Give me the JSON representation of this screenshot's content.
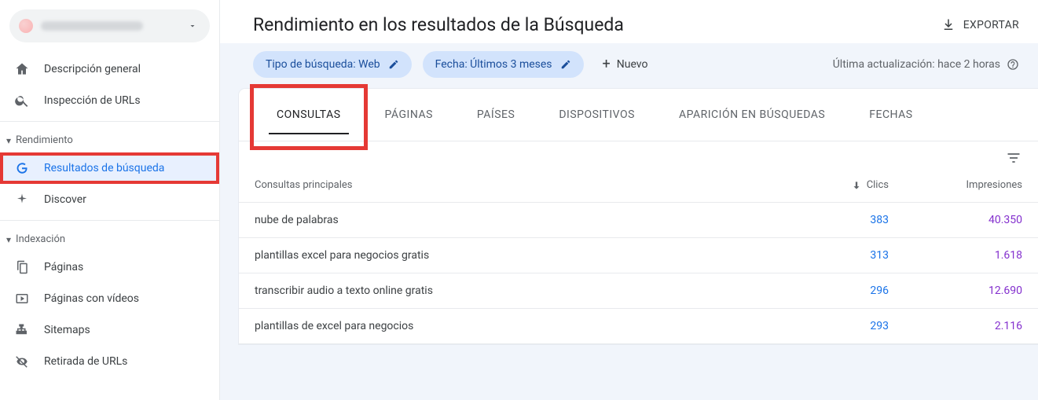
{
  "header": {
    "page_title": "Rendimiento en los resultados de la Búsqueda",
    "export_label": "EXPORTAR"
  },
  "filters": {
    "search_type_chip": "Tipo de búsqueda: Web",
    "date_chip": "Fecha: Últimos 3 meses",
    "new_label": "Nuevo",
    "last_update": "Última actualización: hace 2 horas"
  },
  "sidebar": {
    "items_top": [
      {
        "label": "Descripción general",
        "icon": "home"
      },
      {
        "label": "Inspección de URLs",
        "icon": "search"
      }
    ],
    "section_rendimiento": {
      "title": "Rendimiento",
      "items": [
        {
          "label": "Resultados de búsqueda",
          "icon": "google",
          "active": true,
          "highlight": true
        },
        {
          "label": "Discover",
          "icon": "asterisk"
        }
      ]
    },
    "section_indexacion": {
      "title": "Indexación",
      "items": [
        {
          "label": "Páginas",
          "icon": "pages"
        },
        {
          "label": "Páginas con vídeos",
          "icon": "video"
        },
        {
          "label": "Sitemaps",
          "icon": "sitemap"
        },
        {
          "label": "Retirada de URLs",
          "icon": "hide"
        }
      ]
    }
  },
  "tabs": [
    {
      "label": "CONSULTAS",
      "active": true
    },
    {
      "label": "PÁGINAS"
    },
    {
      "label": "PAÍSES"
    },
    {
      "label": "DISPOSITIVOS"
    },
    {
      "label": "APARICIÓN EN BÚSQUEDAS"
    },
    {
      "label": "FECHAS"
    }
  ],
  "table": {
    "header_query": "Consultas principales",
    "header_clicks": "Clics",
    "header_impressions": "Impresiones",
    "rows": [
      {
        "query": "nube de palabras",
        "clicks": "383",
        "impressions": "40.350"
      },
      {
        "query": "plantillas excel para negocios gratis",
        "clicks": "313",
        "impressions": "1.618"
      },
      {
        "query": "transcribir audio a texto online gratis",
        "clicks": "296",
        "impressions": "12.690"
      },
      {
        "query": "plantillas de excel para negocios",
        "clicks": "293",
        "impressions": "2.116"
      }
    ]
  }
}
